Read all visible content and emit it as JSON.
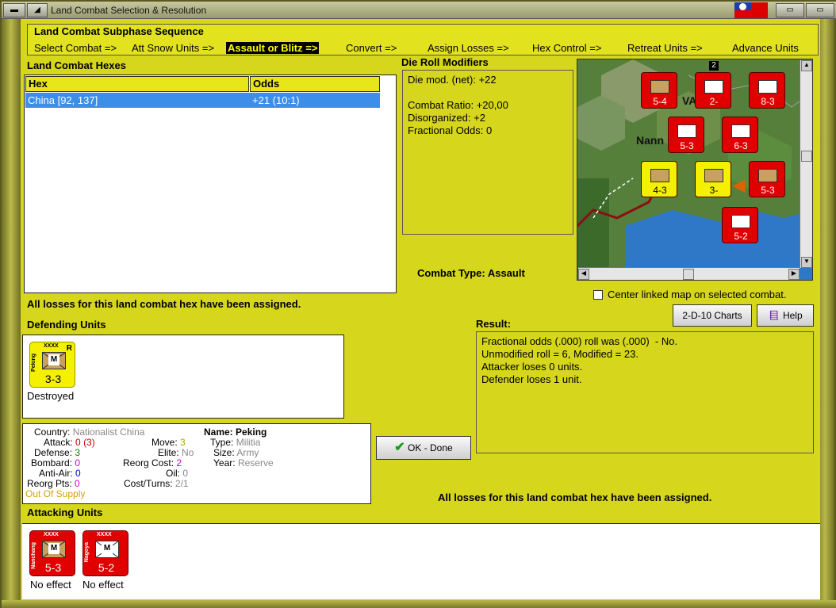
{
  "window": {
    "title": "Land Combat Selection & Resolution",
    "colors": {
      "frame": "#9a9a3a",
      "panel": "#d6d61c",
      "selection": "#3c8ee8"
    }
  },
  "sequence": {
    "title": "Land Combat Subphase Sequence",
    "steps": [
      {
        "label": "Select Combat =>",
        "active": false
      },
      {
        "label": "Att Snow Units =>",
        "active": false
      },
      {
        "label": "Assault or Blitz =>",
        "active": true
      },
      {
        "label": "Convert =>",
        "active": false
      },
      {
        "label": "Assign Losses =>",
        "active": false
      },
      {
        "label": "Hex Control =>",
        "active": false
      },
      {
        "label": "Retreat Units =>",
        "active": false
      },
      {
        "label": "Advance Units",
        "active": false
      }
    ]
  },
  "hexes": {
    "label": "Land Combat Hexes",
    "columns": [
      "Hex",
      "Odds"
    ],
    "rows": [
      {
        "hex": "China [92, 137]",
        "odds": "+21 (10:1)"
      }
    ]
  },
  "die_roll": {
    "label": "Die Roll Modifiers",
    "lines": [
      "Die mod. (net): +22",
      "",
      "Combat Ratio: +20,00",
      "Disorganized: +2",
      "Fractional Odds: 0"
    ]
  },
  "combat_type": "Combat Type:  Assault",
  "map": {
    "place": "Nann",
    "partial_label": "VA",
    "badge": "2",
    "units": [
      {
        "value": "5-4",
        "color": "red",
        "xx": "XXXX"
      },
      {
        "value": "2-",
        "color": "red",
        "xx": "XX"
      },
      {
        "value": "8-3",
        "color": "red",
        "xx": "XXXX",
        "r": "R"
      },
      {
        "value": "5-3",
        "color": "red",
        "xx": "XXXX",
        "r": "R"
      },
      {
        "value": "6-3",
        "color": "red",
        "xx": "XX"
      },
      {
        "value": "4-3",
        "color": "yellow",
        "xx": "XXXX"
      },
      {
        "value": "3-",
        "color": "yellow",
        "xx": "XXXX",
        "r": "R"
      },
      {
        "value": "5-3",
        "color": "red",
        "xx": ""
      },
      {
        "value": "5-2",
        "color": "red",
        "xx": "XXXX"
      }
    ]
  },
  "center_map_label": "Center linked map on selected combat.",
  "buttons": {
    "charts": "2-D-10 Charts",
    "help": "Help",
    "ok": "OK - Done"
  },
  "losses_msg": "All losses for this land combat hex have been assigned.",
  "result": {
    "label": "Result:",
    "lines": [
      "Fractional odds (.000) roll was (.000)  - No.",
      "Unmodified roll = 6, Modified = 23.",
      "Attacker loses 0 units.",
      "Defender loses 1 unit."
    ]
  },
  "defending": {
    "label": "Defending Units",
    "units": [
      {
        "name": "Peking",
        "xx": "XXXX",
        "r": "R",
        "value": "3-3",
        "type": "M",
        "status": "Destroyed"
      }
    ]
  },
  "unit_info": {
    "country_k": "Country:",
    "country": "Nationalist China",
    "attack_k": "Attack:",
    "attack": "0",
    "attack_x": "(3)",
    "defense_k": "Defense:",
    "defense": "3",
    "bombard_k": "Bombard:",
    "bombard": "0",
    "aa_k": "Anti-Air:",
    "aa": "0",
    "reorg_k": "Reorg Pts:",
    "reorg": "0",
    "supply": "Out Of Supply",
    "move_k": "Move:",
    "move": "3",
    "elite_k": "Elite:",
    "elite": "No",
    "rc_k": "Reorg Cost:",
    "rc": "2",
    "oil_k": "Oil:",
    "oil": "0",
    "ct_k": "Cost/Turns:",
    "ct": "2/1",
    "name_k": "Name:",
    "name": "Peking",
    "type_k": "Type:",
    "type": "Militia",
    "size_k": "Size:",
    "size": "Army",
    "year_k": "Year:",
    "year": "Reserve"
  },
  "attacking": {
    "label": "Attacking Units",
    "units": [
      {
        "name": "Nanchang",
        "xx": "XXXX",
        "value": "5-3",
        "type": "M",
        "status": "No effect"
      },
      {
        "name": "Nagoya",
        "xx": "XXXX",
        "value": "5-2",
        "type": "M",
        "status": "No effect"
      }
    ]
  }
}
